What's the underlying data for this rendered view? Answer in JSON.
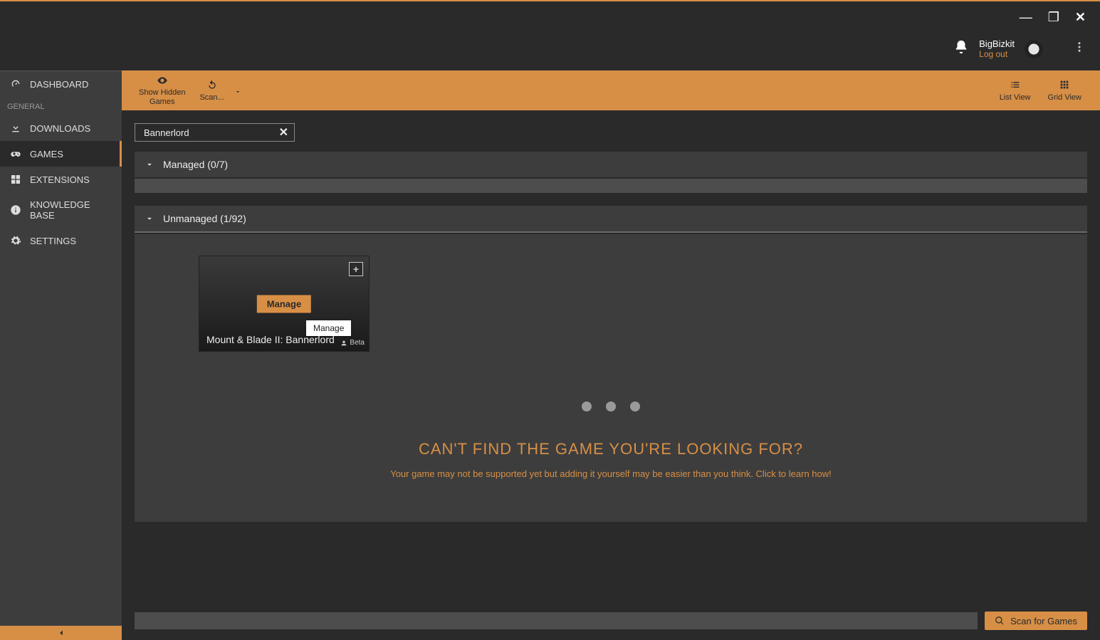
{
  "window": {
    "minimize": "—",
    "maximize": "❐",
    "close": "✕"
  },
  "user": {
    "name": "BigBizkit",
    "logout_label": "Log out"
  },
  "sidebar": {
    "dashboard": "DASHBOARD",
    "section_general": "GENERAL",
    "downloads": "DOWNLOADS",
    "games": "GAMES",
    "extensions": "EXTENSIONS",
    "knowledge": "KNOWLEDGE BASE",
    "settings": "SETTINGS"
  },
  "toolbar": {
    "show_hidden": "Show Hidden\nGames",
    "scan": "Scan...",
    "list_view": "List View",
    "grid_view": "Grid View"
  },
  "search": {
    "value": "Bannerlord"
  },
  "sections": {
    "managed": "Managed (0/7)",
    "unmanaged": "Unmanaged (1/92)"
  },
  "game_card": {
    "title": "Mount & Blade II: Bannerlord",
    "manage_label": "Manage",
    "tooltip": "Manage",
    "plus": "+",
    "beta": "Beta"
  },
  "help": {
    "title": "Can't find the game you're looking for?",
    "subtitle": "Your game may not be supported yet but adding it yourself may be easier than you think. Click to learn how!"
  },
  "bottom": {
    "scan_for_games": "Scan for Games"
  }
}
